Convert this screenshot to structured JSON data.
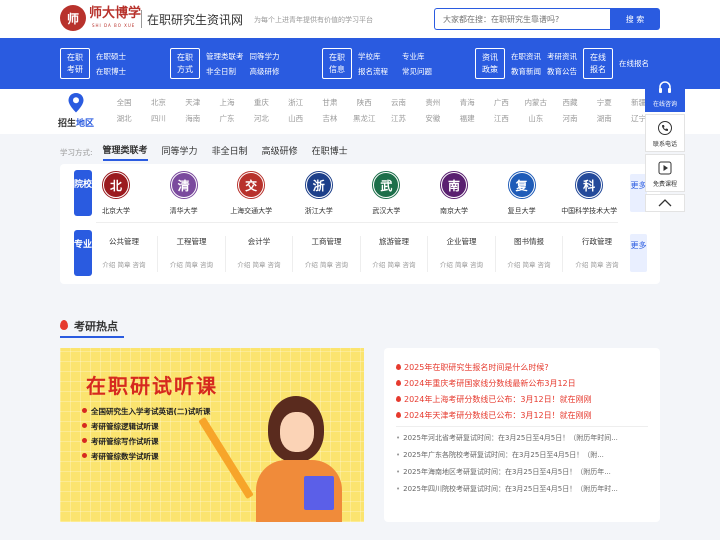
{
  "header": {
    "logo_char": "师",
    "brand": "师大博学",
    "brand_sub": "SHI DA BO XUE",
    "site_title": "在职研究生资讯网",
    "slogan": "为每个上进青年提供有价值的学习平台",
    "search_placeholder": "大家都在搜：在职研究生靠谱吗?",
    "search_button": "搜 索"
  },
  "nav": [
    {
      "box": [
        "在职",
        "考研"
      ],
      "links": [
        "在职硕士",
        "在职博士"
      ]
    },
    {
      "box": [
        "在职",
        "方式"
      ],
      "links": [
        "管理类联考",
        "同等学力",
        "非全日制",
        "高级研修"
      ]
    },
    {
      "box": [
        "在职",
        "信息"
      ],
      "links": [
        "学校库",
        "专业库",
        "报名流程",
        "常见问题"
      ]
    },
    {
      "box": [
        "资讯",
        "政策"
      ],
      "links": [
        "在职资讯",
        "考研资讯",
        "教育新闻",
        "教育公告"
      ]
    },
    {
      "box": [
        "在线",
        "报名"
      ],
      "links": [
        "在线报名"
      ]
    }
  ],
  "region": {
    "label_a": "招生",
    "label_b": "地区",
    "row1": [
      "全国",
      "北京",
      "天津",
      "上海",
      "重庆",
      "浙江",
      "甘肃",
      "陕西",
      "云南",
      "贵州",
      "青海",
      "广西",
      "内蒙古",
      "西藏",
      "宁夏",
      "新疆"
    ],
    "row2": [
      "湖北",
      "四川",
      "海南",
      "广东",
      "河北",
      "山西",
      "吉林",
      "黑龙江",
      "江苏",
      "安徽",
      "福建",
      "江西",
      "山东",
      "河南",
      "湖南",
      "辽宁"
    ]
  },
  "study": {
    "label": "学习方式:",
    "tabs": [
      "管理类联考",
      "同等学力",
      "非全日制",
      "高级研修",
      "在职博士"
    ]
  },
  "panel": {
    "school_label": "院校",
    "major_label": "专业",
    "more": "更多",
    "schools": [
      {
        "name": "北京大学",
        "char": "北",
        "color": "#9b1b1f"
      },
      {
        "name": "清华大学",
        "char": "清",
        "color": "#7b4a9e"
      },
      {
        "name": "上海交通大学",
        "char": "交",
        "color": "#b8322c"
      },
      {
        "name": "浙江大学",
        "char": "浙",
        "color": "#1c3f8a"
      },
      {
        "name": "武汉大学",
        "char": "武",
        "color": "#1d6f4a"
      },
      {
        "name": "南京大学",
        "char": "南",
        "color": "#5a2070"
      },
      {
        "name": "复旦大学",
        "char": "复",
        "color": "#1f5cb8"
      },
      {
        "name": "中国科学技术大学",
        "char": "科",
        "color": "#244a9a"
      }
    ],
    "majors": [
      "公共管理",
      "工程管理",
      "会计学",
      "工商管理",
      "旅游管理",
      "企业管理",
      "图书情报",
      "行政管理"
    ],
    "major_sub": "介绍  简章  咨询"
  },
  "hot": {
    "title": "考研热点",
    "banner_title": "在职研试听课",
    "banner_items": [
      "全国研究生入学考试英语(二)试听课",
      "考研管综逻辑试听课",
      "考研管综写作试听课",
      "考研管综数学试听课"
    ],
    "headlines": [
      "2025年在职研究生报名时间是什么时候?",
      "2024年重庆考研国家线分数线最新公布3月12日",
      "2024年上海考研分数线已公布：3月12日！就在刚刚",
      "2024年天津考研分数线已公布：3月12日！就在刚刚"
    ],
    "items": [
      "2025年河北省考研复试时间：在3月25日至4月5日！（附历年时间...",
      "2025年广东各院校考研复试时间：在3月25日至4月5日！（附...",
      "2025年海南地区考研复试时间：在3月25日至4月5日！（附历年...",
      "2025年四川院校考研复试时间：在3月25日至4月5日！（附历年时..."
    ]
  },
  "float": {
    "online": "在线咨询",
    "phone": "联系电话",
    "course": "免费课程"
  },
  "colors": {
    "primary": "#2a5be0",
    "hot": "#e63a2e",
    "brand": "#b8322c"
  }
}
